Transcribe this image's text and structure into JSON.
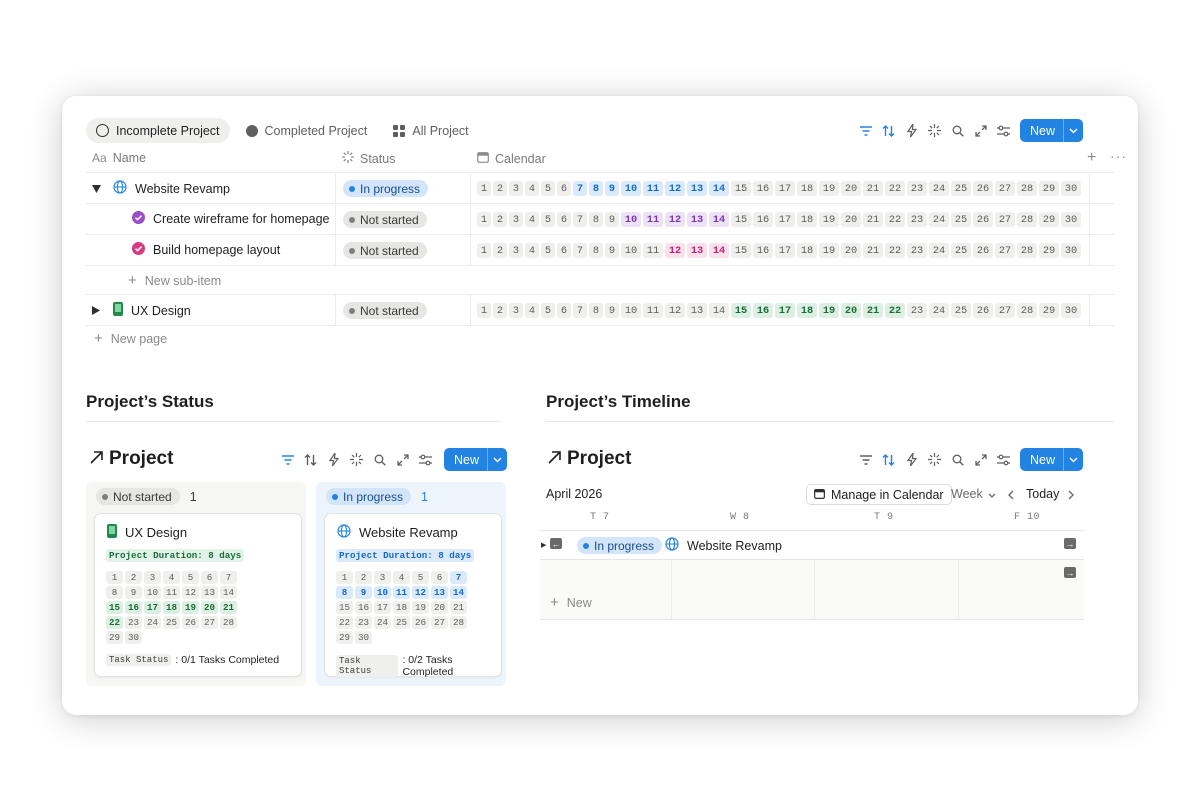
{
  "tabs": [
    {
      "label": "Incomplete Project",
      "icon": "circle-outline-icon",
      "active": true
    },
    {
      "label": "Completed Project",
      "icon": "circle-filled-icon",
      "active": false
    },
    {
      "label": "All Project",
      "icon": "grid-icon",
      "active": false
    }
  ],
  "new_label": "New",
  "table": {
    "headers": {
      "name_prefix": "Aa",
      "name": "Name",
      "status": "Status",
      "calendar": "Calendar"
    },
    "rows": [
      {
        "name": "Website Revamp",
        "icon": "globe-icon",
        "expanded": true,
        "status": "In progress",
        "status_color": "blue",
        "highlight": [
          7,
          8,
          9,
          10,
          11,
          12,
          13,
          14
        ],
        "hl_class": "b"
      },
      {
        "name": "Create wireframe for homepage",
        "icon": "check-circle-purple-icon",
        "sub": true,
        "status": "Not started",
        "status_color": "gray",
        "highlight": [
          10,
          11,
          12,
          13,
          14
        ],
        "hl_class": "p"
      },
      {
        "name": "Build homepage layout",
        "icon": "check-circle-pink-icon",
        "sub": true,
        "status": "Not started",
        "status_color": "gray",
        "highlight": [
          12,
          13,
          14
        ],
        "hl_class": "r"
      },
      {
        "name": "UX Design",
        "icon": "phone-icon",
        "expanded": false,
        "status": "Not started",
        "status_color": "gray",
        "highlight": [
          15,
          16,
          17,
          18,
          19,
          20,
          21,
          22
        ],
        "hl_class": "g"
      }
    ],
    "new_sub_item": "New sub-item",
    "new_page": "New page"
  },
  "status_section": {
    "title": "Project’s Status",
    "db_title": "Project",
    "columns": [
      {
        "label": "Not started",
        "count": "1",
        "card": {
          "name": "UX Design",
          "duration": "Project Duration: 8 days",
          "highlight": [
            15,
            16,
            17,
            18,
            19,
            20,
            21,
            22
          ],
          "task_key": "Task Status",
          "task_value": ": 0/1 Tasks Completed"
        }
      },
      {
        "label": "In progress",
        "count": "1",
        "card": {
          "name": "Website Revamp",
          "duration": "Project Duration: 8 days",
          "highlight": [
            7,
            8,
            9,
            10,
            11,
            12,
            13,
            14
          ],
          "task_key": "Task Status",
          "task_value": ": 0/2 Tasks Completed"
        }
      }
    ]
  },
  "timeline_section": {
    "title": "Project’s Timeline",
    "db_title": "Project",
    "month": "April 2026",
    "manage": "Manage in Calendar",
    "range": "Week",
    "today": "Today",
    "days": [
      "T 7",
      "W 8",
      "T 9",
      "F 10"
    ],
    "bar_status": "In progress",
    "bar_name": "Website Revamp",
    "new_label": "New"
  },
  "colors": {
    "accent": "#2383e2",
    "blue": "#1769c7",
    "purple": "#7a35b5",
    "pink": "#c81e6e",
    "green": "#1a6d3a"
  }
}
